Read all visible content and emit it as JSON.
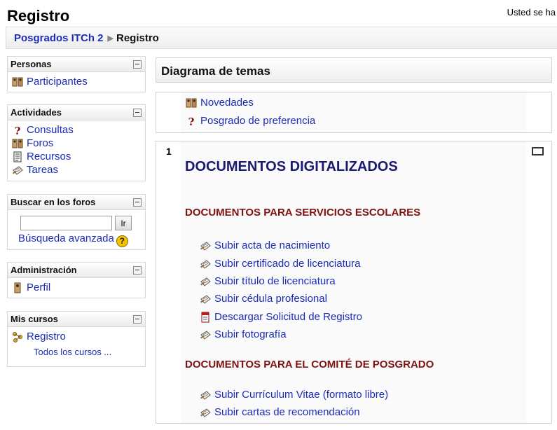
{
  "header": {
    "title": "Registro",
    "login_info": "Usted se ha"
  },
  "breadcrumb": {
    "items": [
      "Posgrados ITCh 2",
      "Registro"
    ],
    "separator": "▶"
  },
  "blocks": {
    "personas": {
      "title": "Personas",
      "items": [
        {
          "label": "Participantes",
          "icon": "people-icon"
        }
      ]
    },
    "actividades": {
      "title": "Actividades",
      "items": [
        {
          "label": "Consultas",
          "icon": "question-icon"
        },
        {
          "label": "Foros",
          "icon": "people-icon"
        },
        {
          "label": "Recursos",
          "icon": "document-icon"
        },
        {
          "label": "Tareas",
          "icon": "assignment-icon"
        }
      ]
    },
    "buscar": {
      "title": "Buscar en los foros",
      "input_value": "",
      "button_label": "Ir",
      "advanced_label": "Búsqueda avanzada",
      "help_glyph": "?"
    },
    "administracion": {
      "title": "Administración",
      "items": [
        {
          "label": "Perfil",
          "icon": "person-icon"
        }
      ]
    },
    "mis_cursos": {
      "title": "Mis cursos",
      "items": [
        {
          "label": "Registro",
          "icon": "course-icon"
        }
      ],
      "all_courses": "Todos los cursos ..."
    }
  },
  "main": {
    "diagram_title": "Diagrama de temas",
    "section0": {
      "links": [
        {
          "label": "Novedades",
          "icon": "people-icon"
        },
        {
          "label": "Posgrado de preferencia",
          "icon": "question-icon"
        }
      ]
    },
    "section1": {
      "number": "1",
      "heading": "DOCUMENTOS DIGITALIZADOS",
      "subheading1": "DOCUMENTOS PARA SERVICIOS ESCOLARES",
      "group1": [
        {
          "label": "Subir acta de nacimiento",
          "icon": "assignment-icon"
        },
        {
          "label": "Subir certificado de licenciatura",
          "icon": "assignment-icon"
        },
        {
          "label": "Subir título de licenciatura",
          "icon": "assignment-icon"
        },
        {
          "label": "Subir cédula profesional",
          "icon": "assignment-icon"
        },
        {
          "label": "Descargar Solicitud de Registro",
          "icon": "pdf-icon"
        },
        {
          "label": "Subir fotografía",
          "icon": "assignment-icon"
        }
      ],
      "subheading2": "DOCUMENTOS PARA EL COMITÉ DE POSGRADO",
      "group2": [
        {
          "label": "Subir Currículum Vitae (formato libre)",
          "icon": "assignment-icon"
        },
        {
          "label": "Subir cartas de recomendación",
          "icon": "assignment-icon"
        }
      ]
    }
  },
  "colors": {
    "link": "#1a2cb8",
    "heading_dark_blue": "#1a1a6e",
    "subheading_dark_red": "#7e1212"
  }
}
